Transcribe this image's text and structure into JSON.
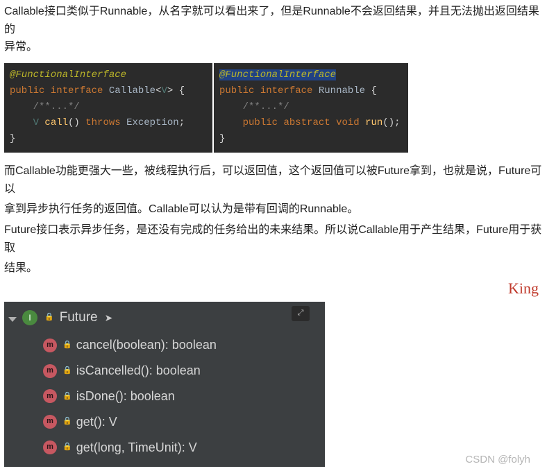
{
  "intro": {
    "p1a": "Callable接口类似于Runnable，从名字就可以看出来了，但是Runnable不会返回结果，并且无法抛出返回结果的",
    "p1b": "异常。"
  },
  "code": {
    "callable": {
      "l1_anno": "@FunctionalInterface",
      "l2_pub": "public",
      "l2_if": "interface",
      "l2_name": "Callable",
      "l2_open": "<",
      "l2_gen": "V",
      "l2_close": ">",
      "l2_brace": " {",
      "l3_comment": "/**...*/",
      "l4_ret": "V",
      "l4_name": "call",
      "l4_paren": "()",
      "l4_throws": "throws",
      "l4_exc": "Exception",
      "l4_semi": ";",
      "l5_brace": "}"
    },
    "runnable": {
      "l1_anno": "@FunctionalInterface",
      "l2_pub": "public",
      "l2_if": "interface",
      "l2_name": "Runnable",
      "l2_brace": " {",
      "l3_comment": "/**...*/",
      "l4_pub": "public",
      "l4_abs": "abstract",
      "l4_void": "void",
      "l4_name": "run",
      "l4_paren": "()",
      "l4_semi": ";",
      "l5_brace": "}"
    }
  },
  "mid": {
    "p1": "而Callable功能更强大一些，被线程执行后，可以返回值，这个返回值可以被Future拿到，也就是说，Future可以",
    "p2": "拿到异步执行任务的返回值。Callable可以认为是带有回调的Runnable。",
    "p3": "Future接口表示异步任务，是还没有完成的任务给出的未来结果。所以说Callable用于产生结果，Future用于获取",
    "p4": "结果。"
  },
  "king": "King",
  "ide": {
    "root": "Future",
    "toolbar_icon": "⤢",
    "methods": [
      "cancel(boolean): boolean",
      "isCancelled(): boolean",
      "isDone(): boolean",
      "get(): V",
      "get(long, TimeUnit): V"
    ]
  },
  "watermark": "CSDN @folyh"
}
